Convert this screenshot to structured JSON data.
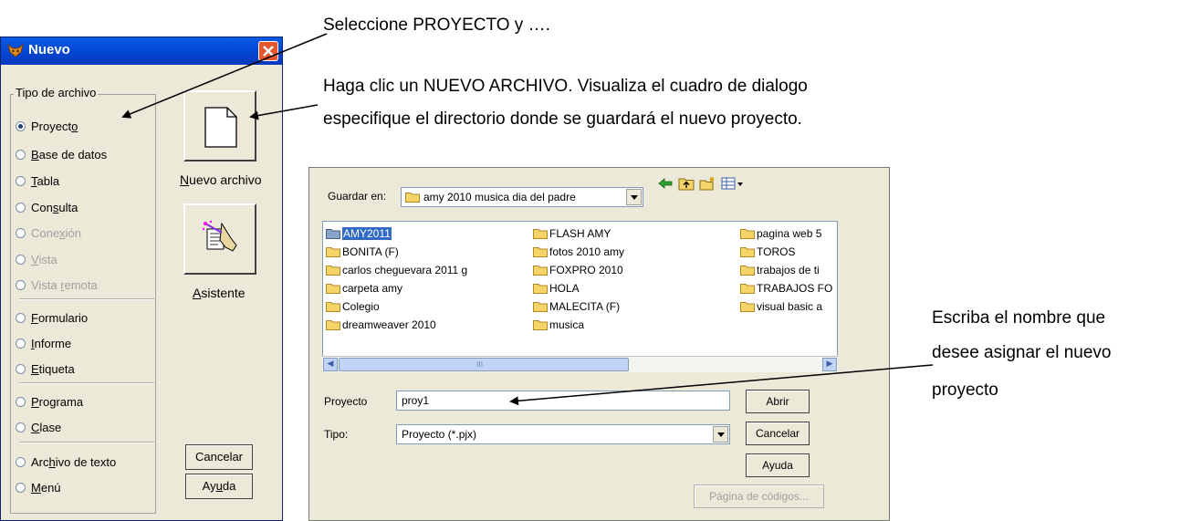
{
  "captions": {
    "step1": "Seleccione PROYECTO y ….",
    "step2_line1": "Haga clic un NUEVO ARCHIVO. Visualiza el cuadro de dialogo",
    "step2_line2": "especifique el directorio donde se guardará el nuevo proyecto.",
    "step3_line1": "Escriba el nombre que",
    "step3_line2": "desee asignar el nuevo",
    "step3_line3": "proyecto"
  },
  "nuevo_dialog": {
    "title": "Nuevo",
    "group_label": "Tipo de archivo",
    "options": [
      {
        "pre": "Proyect",
        "u": "o",
        "post": "",
        "selected": true,
        "enabled": true
      },
      {
        "pre": "",
        "u": "B",
        "post": "ase de datos",
        "selected": false,
        "enabled": true
      },
      {
        "pre": "",
        "u": "T",
        "post": "abla",
        "selected": false,
        "enabled": true
      },
      {
        "pre": "Con",
        "u": "s",
        "post": "ulta",
        "selected": false,
        "enabled": true
      },
      {
        "pre": "Cone",
        "u": "x",
        "post": "ión",
        "selected": false,
        "enabled": false
      },
      {
        "pre": "",
        "u": "V",
        "post": "ista",
        "selected": false,
        "enabled": false
      },
      {
        "pre": "Vista ",
        "u": "r",
        "post": "emota",
        "selected": false,
        "enabled": false
      },
      {
        "pre": "",
        "u": "F",
        "post": "ormulario",
        "selected": false,
        "enabled": true
      },
      {
        "pre": "",
        "u": "I",
        "post": "nforme",
        "selected": false,
        "enabled": true
      },
      {
        "pre": "",
        "u": "E",
        "post": "tiqueta",
        "selected": false,
        "enabled": true
      },
      {
        "pre": "",
        "u": "P",
        "post": "rograma",
        "selected": false,
        "enabled": true
      },
      {
        "pre": "",
        "u": "C",
        "post": "lase",
        "selected": false,
        "enabled": true
      },
      {
        "pre": "Arc",
        "u": "h",
        "post": "ivo de texto",
        "selected": false,
        "enabled": true
      },
      {
        "pre": "",
        "u": "M",
        "post": "enú",
        "selected": false,
        "enabled": true
      }
    ],
    "new_file": {
      "u": "N",
      "post": "uevo archivo"
    },
    "wizard": {
      "u": "A",
      "post": "sistente"
    },
    "cancel": "Cancelar",
    "help": {
      "pre": "Ay",
      "u": "u",
      "post": "da"
    }
  },
  "save_dialog": {
    "save_in_label": "Guardar en:",
    "save_in_value": "amy 2010 musica dia del padre",
    "files": [
      "AMY2011",
      "BONITA (F)",
      "carlos cheguevara 2011 g",
      "carpeta amy",
      "Colegio",
      "dreamweaver 2010",
      "FLASH AMY",
      "fotos 2010 amy",
      "FOXPRO 2010",
      "HOLA",
      "MALECITA (F)",
      "musica",
      "pagina web 5",
      "TOROS",
      "trabajos de ti",
      "TRABAJOS FO",
      "visual basic a"
    ],
    "selected_file": "AMY2011",
    "name_label": "Proyecto",
    "name_value": "proy1",
    "type_label": "Tipo:",
    "type_value": "Proyecto (*.pjx)",
    "open_button": "Abrir",
    "cancel_button": "Cancelar",
    "help_button": "Ayuda",
    "codepage_button": "Página de códigos...",
    "scroll_grip": "III"
  },
  "colors": {
    "title_bar": "#0347d2",
    "selection": "#316ac5",
    "folder": "#f5d56a",
    "dialog_bg": "#ece9d8"
  }
}
